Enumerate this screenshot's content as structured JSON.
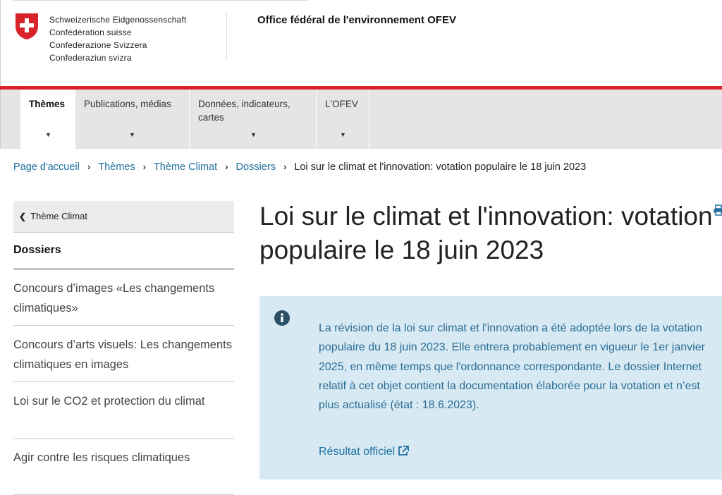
{
  "header": {
    "federation_names": [
      "Schweizerische Eidgenossenschaft",
      "Confédération suisse",
      "Confederazione Svizzera",
      "Confederaziun svizra"
    ],
    "office": "Office fédéral de l'environnement OFEV",
    "crest_icon": "swiss-cross-icon",
    "colors": {
      "red": "#d8232a"
    }
  },
  "nav": {
    "tabs": [
      {
        "label": "Thèmes",
        "active": true
      },
      {
        "label": "Publications, médias",
        "active": false
      },
      {
        "label": "Données, indicateurs, cartes",
        "active": false
      },
      {
        "label": "L'OFEV",
        "active": false
      }
    ]
  },
  "breadcrumb": {
    "items": [
      "Page d'accueil",
      "Thèmes",
      "Thème Climat",
      "Dossiers"
    ],
    "current": "Loi sur le climat et l'innovation: votation populaire le 18 juin 2023"
  },
  "sidebar": {
    "back_label": "Thème Climat",
    "title": "Dossiers",
    "items": [
      "Concours d’images «Les changements climatiques»",
      "Concours d’arts visuels: Les changements climatiques en images",
      "Loi sur le CO2 et protection du climat",
      "Agir contre les risques climatiques"
    ]
  },
  "main": {
    "title": "Loi sur le climat et l'innovation: votation populaire le 18 juin 2023",
    "info": {
      "text": "La révision de la loi sur climat et l'innovation a été  adoptée lors de la votation populaire du 18 juin 2023. Elle entrera probablement en vigueur le 1er janvier 2025, en même temps que l'ordonnance correspondante. Le dossier Internet relatif à cet objet contient la documentation élaborée pour la votation et n’est plus actualisé (état : 18.6.2023).",
      "link_label": "Résultat officiel"
    }
  }
}
